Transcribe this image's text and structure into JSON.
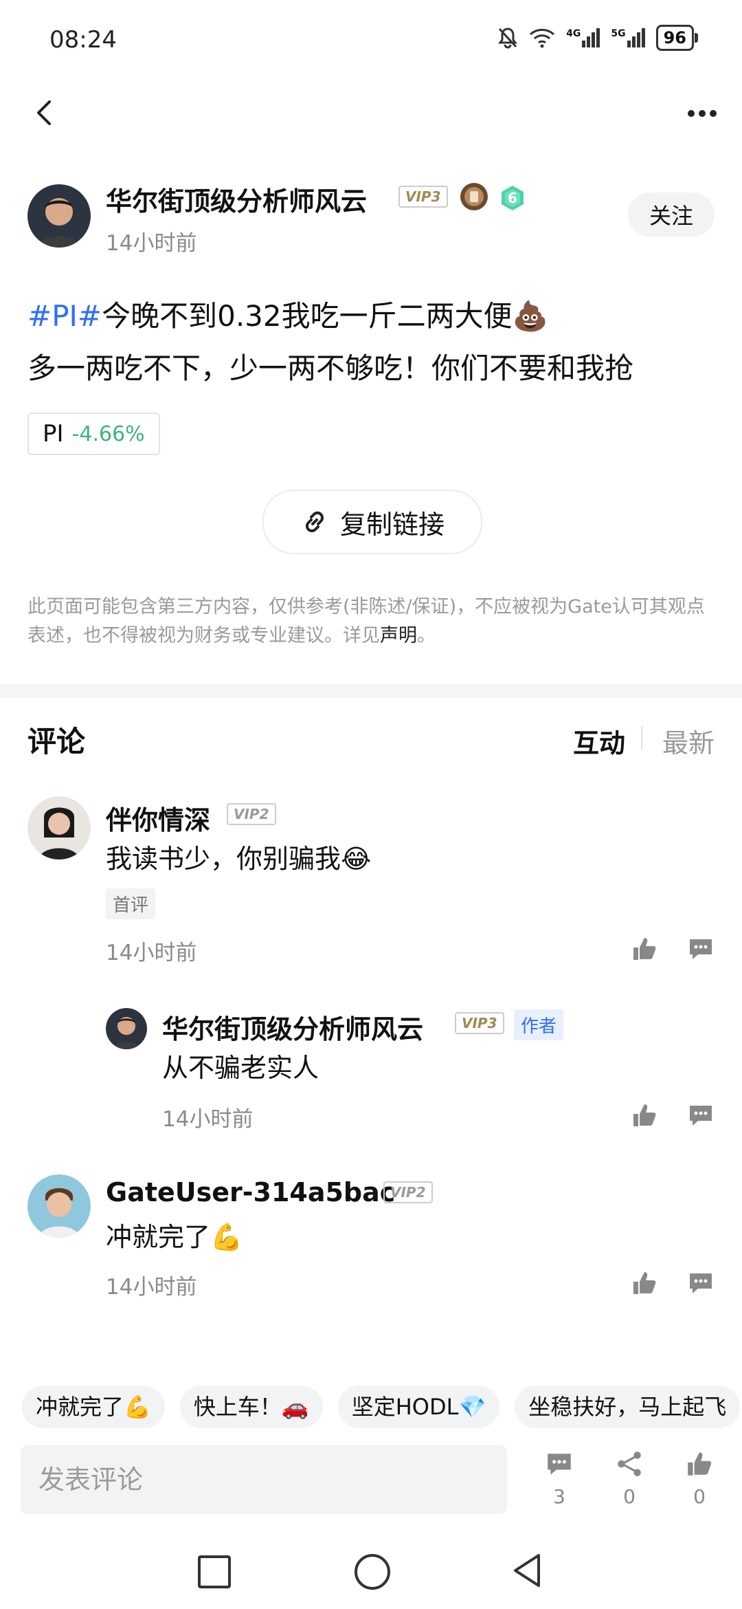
{
  "status_bar": {
    "time": "08:24",
    "net4g": "4G",
    "net5g": "5G",
    "battery": "96"
  },
  "post": {
    "author": {
      "name": "华尔街顶级分析师风云",
      "vip": "VIP3",
      "level": "6",
      "time": "14小时前"
    },
    "follow_label": "关注",
    "hashtag": "#PI#",
    "line1_text": "今晚不到0.32我吃一斤二两大便",
    "line1_emoji": "💩",
    "line2": "多一两吃不下，少一两不够吃！你们不要和我抢",
    "ticker": {
      "symbol": "PI",
      "change": "-4.66%"
    },
    "copy_link_label": "复制链接",
    "disclaimer": "此页面可能包含第三方内容，仅供参考(非陈述/保证)，不应被视为Gate认可其观点表述，也不得被视为财务或专业建议。详见",
    "disclaimer_link": "声明",
    "disclaimer_end": "。"
  },
  "comments_header": {
    "title": "评论",
    "sort_active": "互动",
    "sort_inactive": "最新"
  },
  "comments": [
    {
      "name": "伴你情深",
      "vip": "VIP2",
      "text": "我读书少，你别骗我😂",
      "tag": "首评",
      "time": "14小时前"
    },
    {
      "name": "华尔街顶级分析师风云",
      "vip": "VIP3",
      "tag": "作者",
      "text": "从不骗老实人",
      "time": "14小时前"
    },
    {
      "name": "GateUser-314a5bac",
      "vip": "VIP2",
      "text": "冲就完了💪",
      "time": "14小时前"
    }
  ],
  "quick_replies": [
    "冲就完了💪",
    "快上车！🚗",
    "坚定HODL💎",
    "坐稳扶好，马上起飞"
  ],
  "bottom_bar": {
    "placeholder": "发表评论",
    "comment_count": "3",
    "share_count": "0",
    "like_count": "0"
  }
}
